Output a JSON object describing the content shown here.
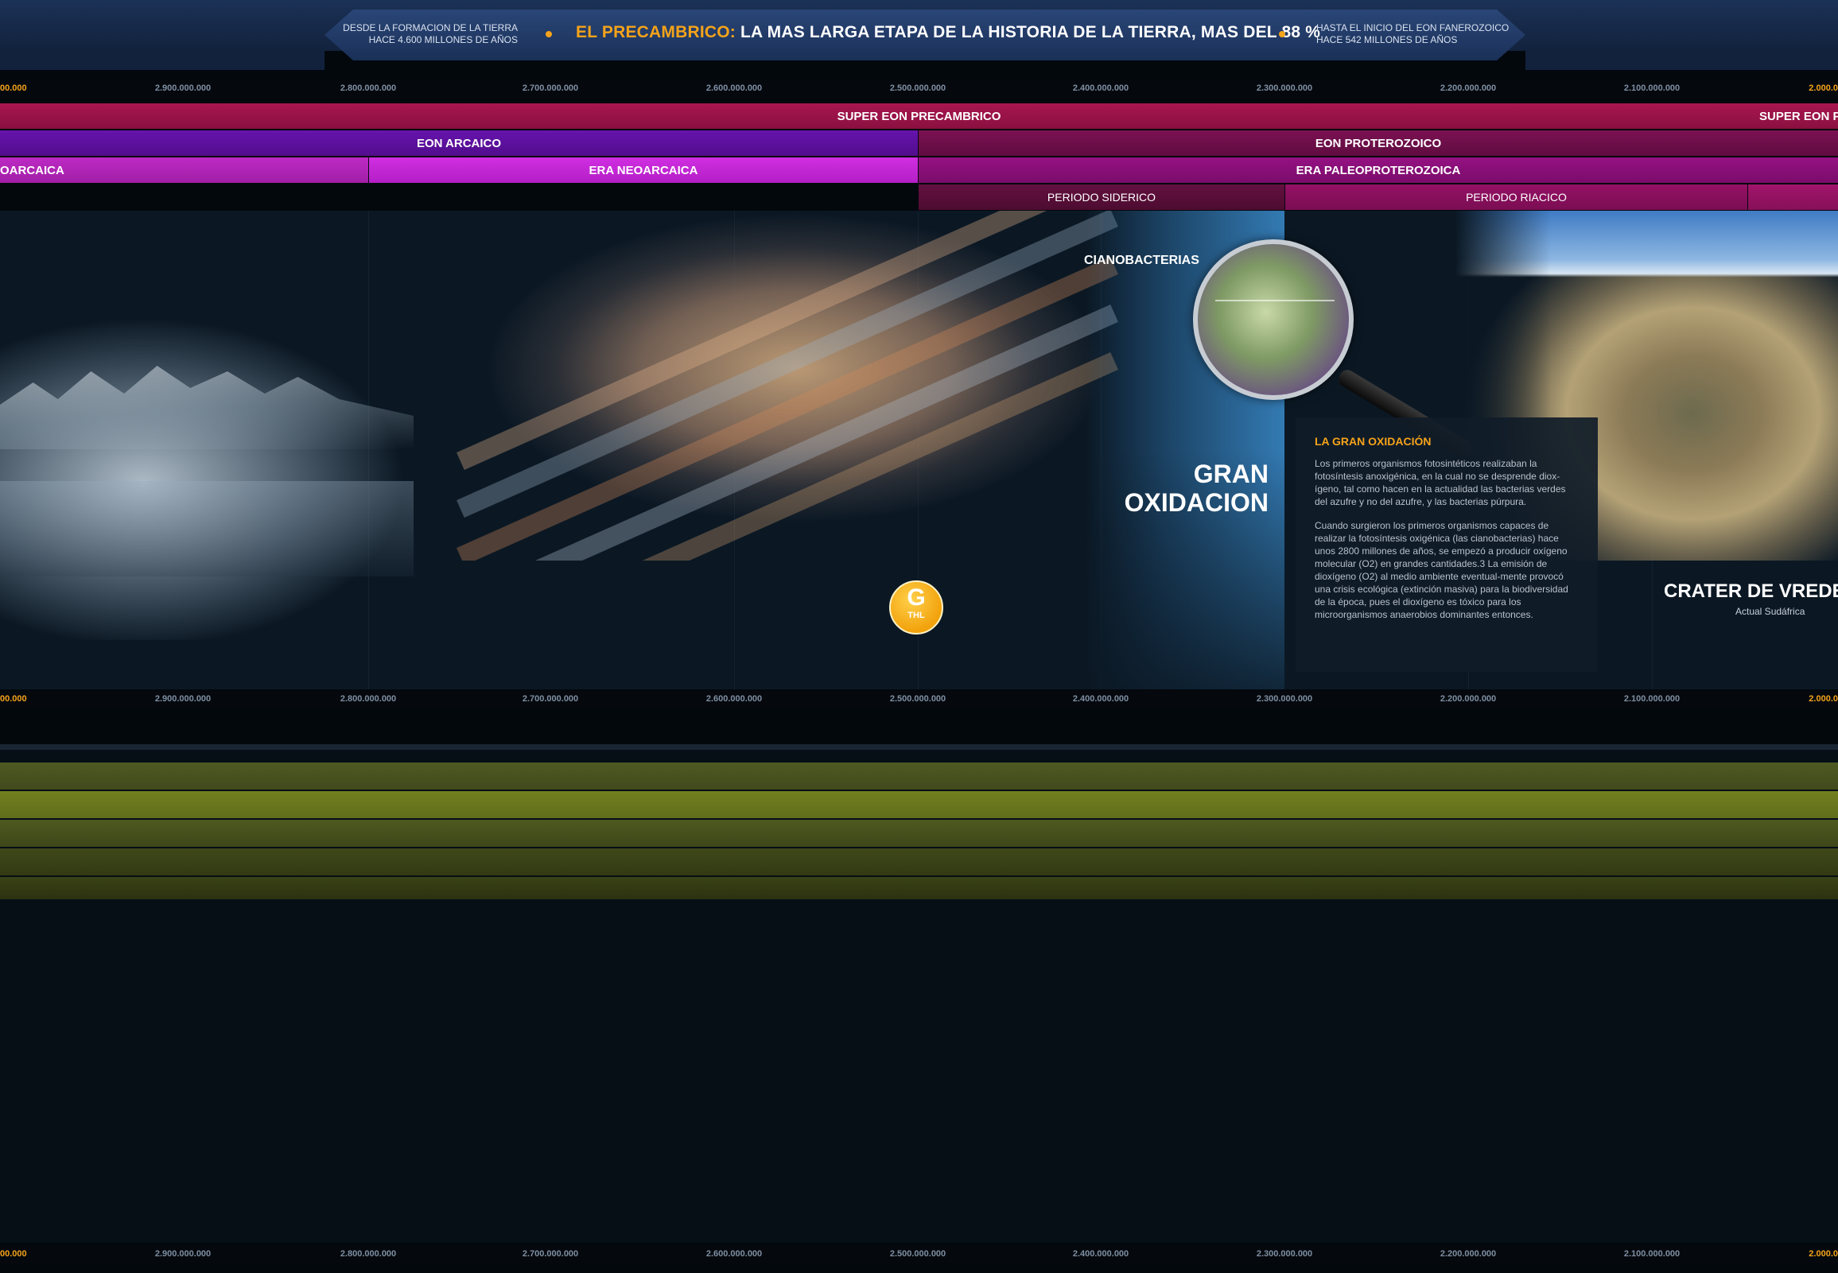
{
  "header": {
    "left_line1": "DESDE LA FORMACION DE LA TIERRA",
    "left_line2": "HACE 4.600 MILLONES DE AÑOS",
    "title_accent": "EL PRECAMBRICO:",
    "title_main": " LA MAS LARGA ETAPA DE LA HISTORIA DE LA TIERRA, MAS DEL 88 %",
    "right_line1": "HASTA EL INICIO DEL EON  FANEROZOICO",
    "right_line2": "HACE 542 MILLONES DE AÑOS"
  },
  "ruler": {
    "edge_left": "00.000",
    "edge_right": "2.000.0",
    "ticks": [
      "2.900.000.000",
      "2.800.000.000",
      "2.700.000.000",
      "2.600.000.000",
      "2.500.000.000",
      "2.400.000.000",
      "2.300.000.000",
      "2.200.000.000",
      "2.100.000.000"
    ]
  },
  "bands": {
    "supereon_center": "SUPER EON PRECAMBRICO",
    "supereon_right": "SUPER EON P",
    "eon_arcaico": "EON ARCAICO",
    "eon_proterozoico": "EON PROTEROZOICO",
    "era_left": "OARCAICA",
    "era_neoarcaica": "ERA NEOARCAICA",
    "era_paleoproterozoica": "ERA PALEOPROTEROZOICA",
    "periodo_siderico": "PERIODO SIDERICO",
    "periodo_riacico": "PERIODO RIACICO"
  },
  "content": {
    "cianobacterias": "CIANOBACTERIAS",
    "gran": "GRAN",
    "oxidacion": "OXIDACION",
    "badge_letter": "G",
    "badge_sub": "THL",
    "info_title": "LA GRAN OXIDACIÓN",
    "info_p1": "Los primeros organismos fotosintéticos realizaban la fotosíntesis anoxigénica, en la cual no se desprende diox-ígeno, tal como hacen en la actualidad las bacterias verdes del azufre y no del azufre, y las bacterias púrpura.",
    "info_p2": "Cuando surgieron los primeros organismos capaces de realizar la fotosíntesis oxigénica (las cianobacterias) hace unos 2800 millones de años, se empezó a producir oxígeno molecular (O2) en grandes cantidades.3 La emisión de dioxígeno (O2) al medio ambiente eventual-mente provocó una crisis ecológica (extinción masiva) para la biodiversidad de la época, pues el dioxígeno es tóxico para los microorganismos anaerobios dominantes entonces.",
    "crater_title": "CRATER DE VREDEF",
    "crater_sub": "Actual Sudáfrica"
  },
  "colors": {
    "accent": "#f5a31a",
    "supereon": "#9a1346",
    "eon_arcaico": "#5c11a0",
    "eon_proterozoico": "#6e0f4a",
    "era_left": "#b225b8",
    "era_neo": "#c424d6",
    "era_paleo": "#8a0f78",
    "siderico": "#5a0d38",
    "riacico": "#8a0f5c"
  }
}
